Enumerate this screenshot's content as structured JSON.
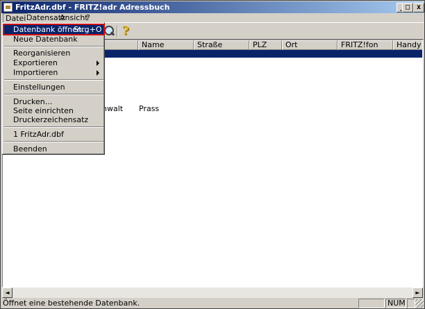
{
  "window": {
    "title": "FritzAdr.dbf - FRITZ!adr Adressbuch",
    "min_label": "_",
    "max_label": "□",
    "close_label": "x"
  },
  "menubar": {
    "items": [
      "Datei",
      "Datensatz",
      "Ansicht",
      "?"
    ]
  },
  "toolbar": {
    "help_label": "?"
  },
  "dropdown": {
    "open_item": {
      "label": "Datenbank öffnen...",
      "shortcut": "Strg+O"
    },
    "items": [
      "Neue Datenbank",
      "Reorganisieren",
      "Exportieren",
      "Importieren",
      "Einstellungen",
      "Drucken...",
      "Seite einrichten",
      "Druckerzeichensatz",
      "1 FritzAdr.dbf",
      "Beenden"
    ]
  },
  "table": {
    "columns": [
      "Name",
      "Straße",
      "PLZ",
      "Ort",
      "FRITZ!fon",
      "Handy"
    ],
    "visible_cells": [
      "nwalt",
      "Prass"
    ]
  },
  "statusbar": {
    "message": "Öffnet eine bestehende Datenbank.",
    "num_indicator": "NUM"
  },
  "scrollbar": {
    "left_arrow": "◄",
    "right_arrow": "►"
  },
  "colors": {
    "titlebar_start": "#0a246a",
    "titlebar_end": "#a6caf0",
    "highlight": "#0a246a",
    "focus_outline": "#d01010",
    "help_icon": "#e0b000"
  }
}
